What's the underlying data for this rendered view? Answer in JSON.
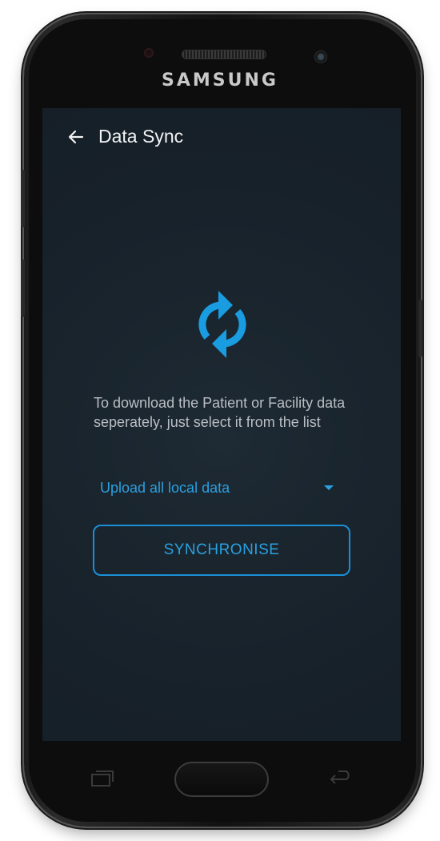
{
  "device": {
    "brand": "SAMSUNG"
  },
  "toolbar": {
    "back_icon": "arrow-left-icon",
    "title": "Data Sync"
  },
  "main": {
    "sync_icon": "sync-icon",
    "description": "To download the Patient or Facility data seperately, just select it from the list",
    "dropdown": {
      "selected": "Upload all local data",
      "caret_icon": "caret-down-icon"
    },
    "sync_button_label": "SYNCHRONISE"
  },
  "colors": {
    "accent": "#2aa0e0",
    "background": "#1a252e",
    "text_primary": "#f2f2f2",
    "text_secondary": "#b9bec4"
  }
}
